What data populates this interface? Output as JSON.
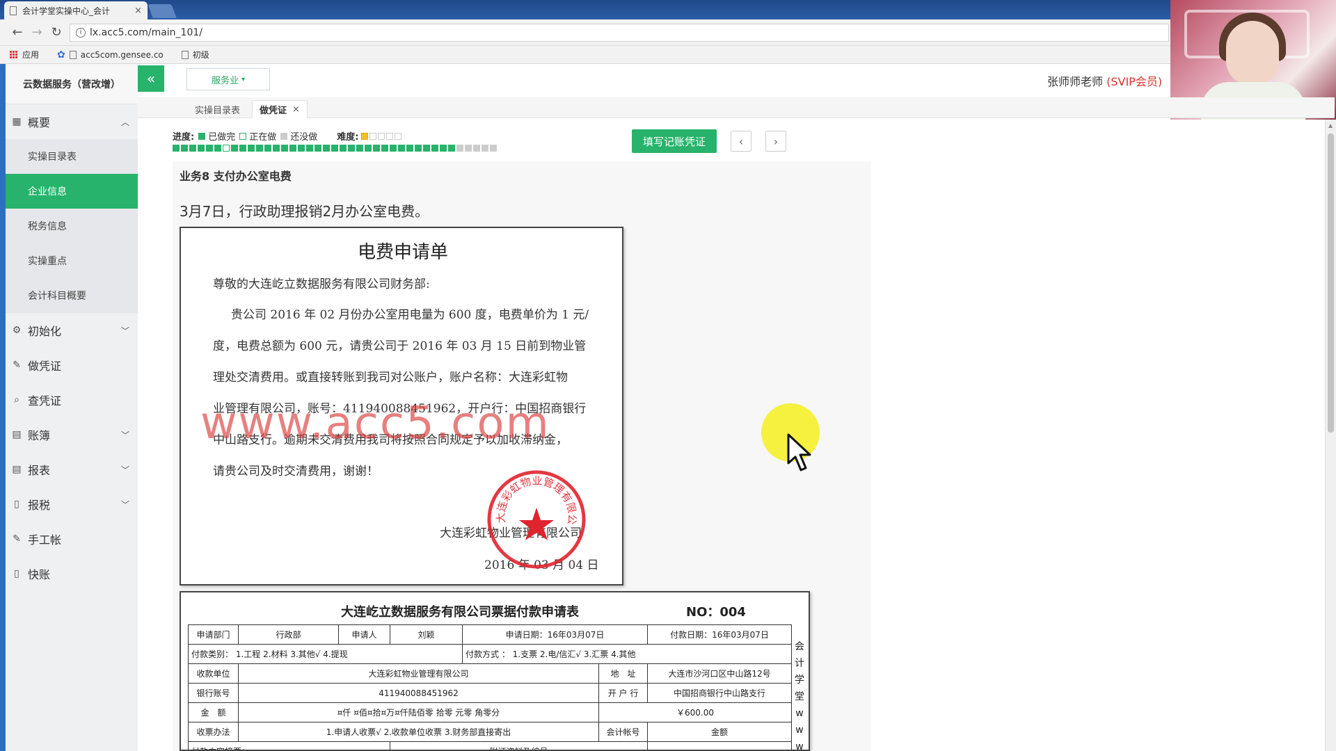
{
  "browser": {
    "tab_title": "会计学堂实操中心_会计",
    "tab_close": "×",
    "url": "lx.acc5.com/main_101/",
    "bookmarks": [
      "应用",
      "acc5com.gensee.co",
      "初级"
    ]
  },
  "app": {
    "company": "云数据服务（营改增）",
    "industry": "服务业",
    "user_name": "张师师老师",
    "user_badge": "(SVIP会员)",
    "collapse_icon": "«"
  },
  "sidebar": {
    "groups": [
      {
        "label": "概要",
        "icon": "overview-icon",
        "expanded": true,
        "items": [
          "实操目录表",
          "企业信息",
          "税务信息",
          "实操重点",
          "会计科目概要"
        ],
        "active": "企业信息"
      },
      {
        "label": "初始化",
        "icon": "gear-icon"
      },
      {
        "label": "做凭证",
        "icon": "pen-icon"
      },
      {
        "label": "查凭证",
        "icon": "search-icon"
      },
      {
        "label": "账簿",
        "icon": "ledger-icon"
      },
      {
        "label": "报表",
        "icon": "report-icon"
      },
      {
        "label": "报税",
        "icon": "document-icon"
      },
      {
        "label": "手工帐",
        "icon": "pen-icon"
      },
      {
        "label": "快账",
        "icon": "document-icon"
      }
    ]
  },
  "page_tabs": [
    {
      "label": "实操目录表",
      "active": false
    },
    {
      "label": "做凭证",
      "active": true,
      "close": "×"
    }
  ],
  "progress": {
    "label": "进度:",
    "done_label": "已做完",
    "doing_label": "正在做",
    "todo_label": "还没做",
    "difficulty_label": "难度:",
    "difficulty": 1,
    "difficulty_max": 5,
    "done_count": 34,
    "total": 39,
    "current_index": 6,
    "colors": {
      "done": "#27b36b",
      "doing": "#ffffff",
      "todo": "#cccccc"
    }
  },
  "actions": {
    "fill_voucher": "填写记账凭证",
    "prev": "‹",
    "next": "›"
  },
  "business": {
    "title": "业务8 支付办公室电费",
    "description": "3月7日，行政助理报销2月办公室电费。"
  },
  "letter": {
    "title": "电费申请单",
    "salutation": "尊敬的大连屹立数据服务有限公司财务部:",
    "lines": [
      "贵公司 2016 年 02 月份办公室用电量为 600 度，电费单价为 1 元/",
      "度，电费总额为 600 元，请贵公司于 2016 年 03 月 15 日前到物业管",
      "理处交清费用。或直接转账到我司对公账户，账户名称：大连彩虹物",
      "业管理有限公司，账号：411940088451962，开户行：中国招商银行",
      "中山路支行。逾期未交清费用我司将按照合同规定予以加收滞纳金，",
      "请贵公司及时交清费用，谢谢！"
    ],
    "signer": "大连彩虹物业管理有限公司",
    "date": "2016 年 03 月 04 日",
    "watermark": "www.acc5.com",
    "seal_text": "大连彩虹物业管理有限公司"
  },
  "payment_form": {
    "title": "大连屹立数据服务有限公司票据付款申请表",
    "no": "NO：004",
    "rows": [
      [
        "申请部门",
        "行政部",
        "申请人",
        "刘颖",
        "申请日期：16年03月07日",
        "付款日期：16年03月07日"
      ],
      [
        "付款类别： 1.工程  2.材料  3.其他√  4.提现",
        "付款方式 ： 1.支票  2.电/信汇√  3.汇票  4.其他"
      ],
      [
        "收款单位",
        "大连彩虹物业管理有限公司",
        "地　址",
        "大连市沙河口区中山路12号"
      ],
      [
        "银行账号",
        "411940088451962",
        "开 户 行",
        "中国招商银行中山路支行"
      ],
      [
        "金　额",
        "¤仟 ¤佰¤拾¤万¤仟陆佰零 拾零 元零 角零分",
        "￥600.00"
      ],
      [
        "收票办法",
        "1.申请人收票√  2.收款单位收票  3.财务部直接寄出",
        "会计帐号",
        "金额"
      ],
      [
        "付款内容摘要：",
        "附证资料及编号"
      ]
    ],
    "side_text": [
      "会",
      "计",
      "学",
      "堂",
      "w",
      "w",
      "w"
    ]
  }
}
